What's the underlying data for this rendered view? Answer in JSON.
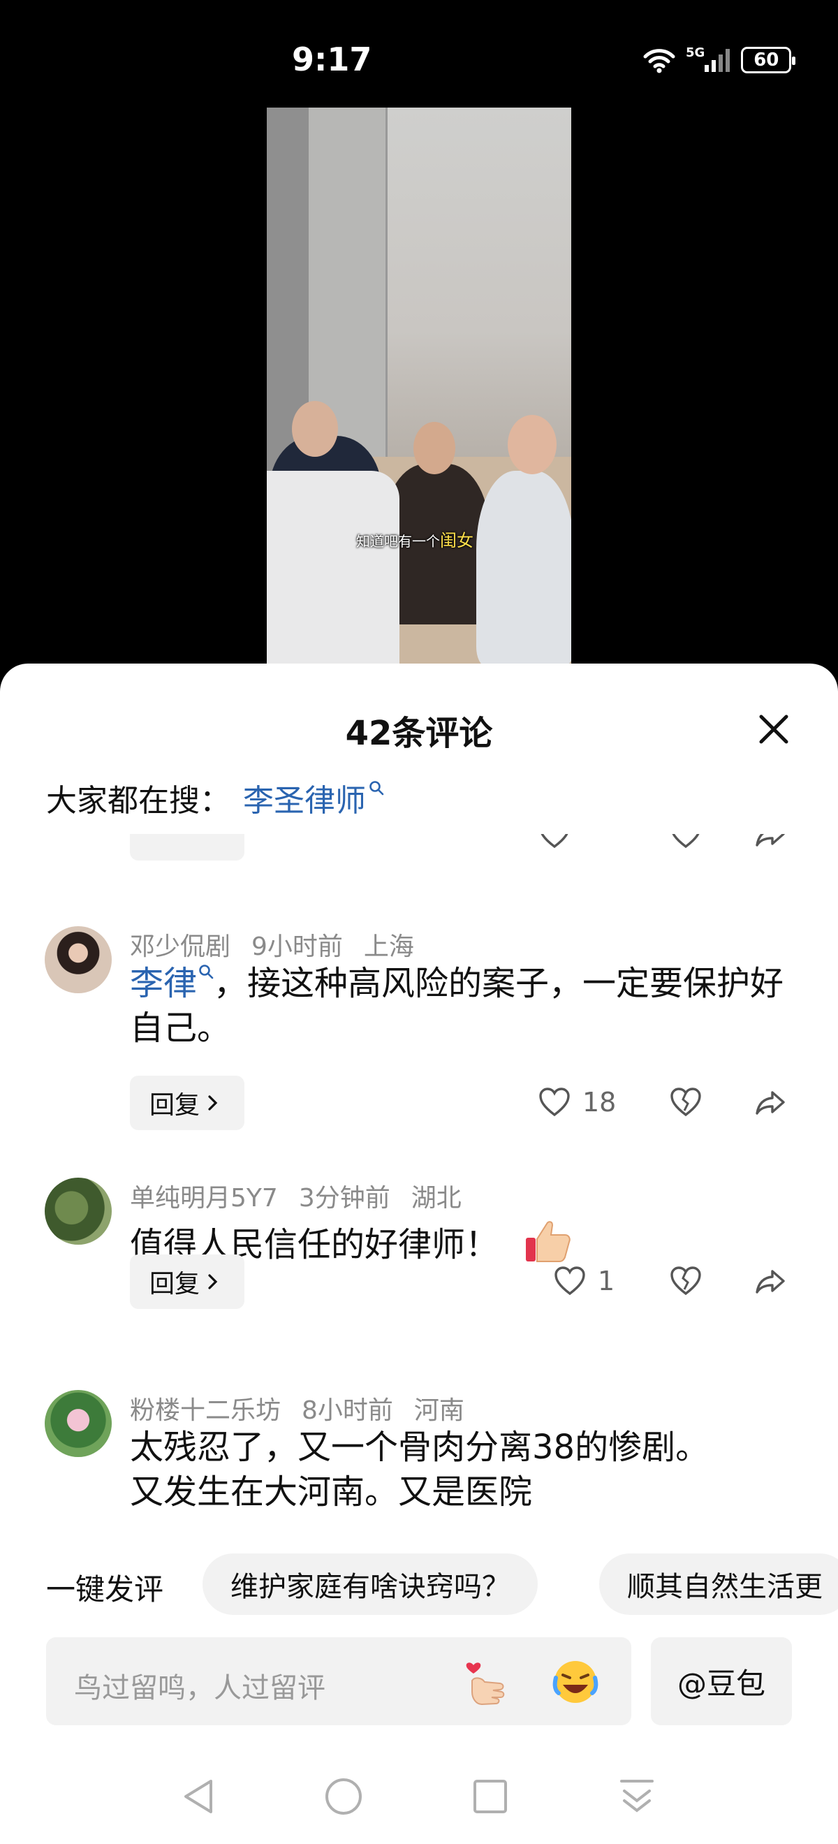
{
  "status_bar": {
    "time": "9:17",
    "network": "5G",
    "battery": "60"
  },
  "video": {
    "subtitle_prefix": "知道吧有一个",
    "subtitle_highlight": "闺女"
  },
  "comments_panel": {
    "title": "42条评论",
    "search_prefix": "大家都在搜：",
    "search_term": "李圣律师",
    "reply_label": "回复"
  },
  "comments": [
    {
      "user": "邓少侃剧",
      "time": "9小时前",
      "location": "上海",
      "mention": "李律",
      "text": "，接这种高风险的案子，一定要保护好自己。",
      "likes": "18"
    },
    {
      "user": "单纯明月5Y7",
      "time": "3分钟前",
      "location": "湖北",
      "text": "值得人民信任的好律师！",
      "emoji": "thumbs-up",
      "likes": "1"
    },
    {
      "user": "粉楼十二乐坊",
      "time": "8小时前",
      "location": "河南",
      "text_line1": "太残忍了，又一个骨肉分离38的惨剧。",
      "text_line2": "又发生在大河南。又是医院"
    }
  ],
  "quick_reply": {
    "label": "一键发评",
    "chips": [
      "维护家庭有啥诀窍吗？",
      "顺其自然生活更"
    ]
  },
  "input": {
    "placeholder": "鸟过留鸣，人过留评",
    "doubao_label": "@豆包"
  },
  "colors": {
    "link": "#2a64b0",
    "meta": "#8a8a8a",
    "chip_bg": "#f2f2f2"
  }
}
